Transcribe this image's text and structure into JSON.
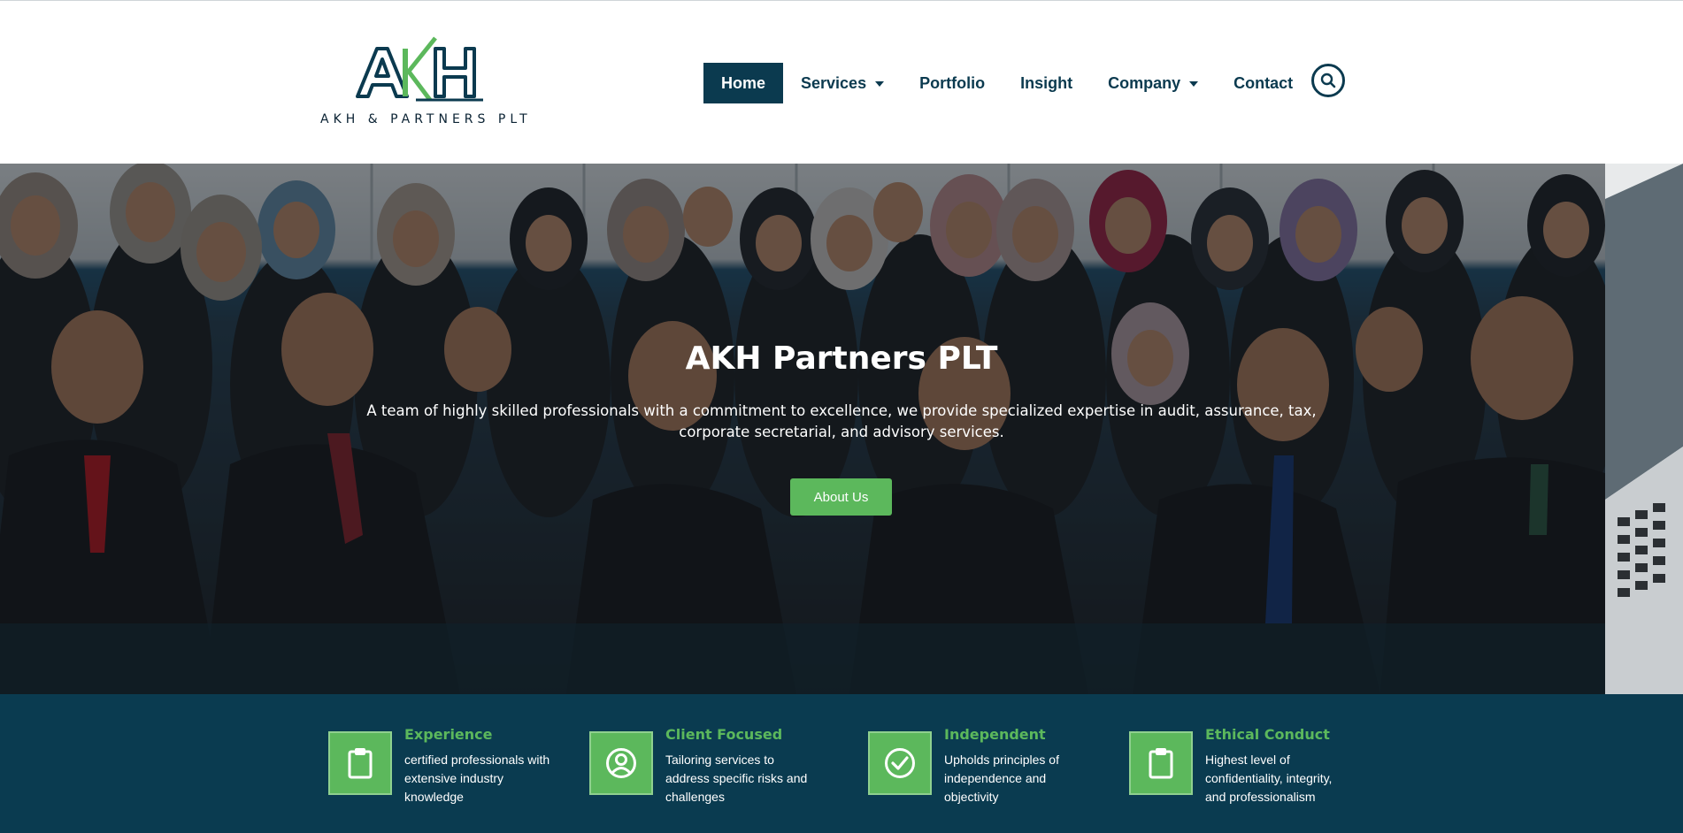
{
  "brand": {
    "logo_letters": "AKH",
    "logo_tagline": "AKH & PARTNERS PLT",
    "colors": {
      "navy": "#0b3a4f",
      "green": "#5cb85c",
      "band": "#0a3b50"
    }
  },
  "nav": {
    "items": [
      {
        "label": "Home",
        "active": true,
        "dropdown": false
      },
      {
        "label": "Services",
        "active": false,
        "dropdown": true
      },
      {
        "label": "Portfolio",
        "active": false,
        "dropdown": false
      },
      {
        "label": "Insight",
        "active": false,
        "dropdown": false
      },
      {
        "label": "Company",
        "active": false,
        "dropdown": true
      },
      {
        "label": "Contact",
        "active": false,
        "dropdown": false
      }
    ],
    "search_icon": "search-icon"
  },
  "hero": {
    "title": "AKH Partners PLT",
    "subtitle": "A team of highly skilled professionals with a commitment to excellence, we provide specialized expertise in audit, assurance, tax, corporate secretarial, and advisory services.",
    "button_label": "About Us"
  },
  "features": [
    {
      "title": "Experience",
      "text": "certified professionals with extensive industry knowledge",
      "icon": "clipboard-icon"
    },
    {
      "title": "Client Focused",
      "text": "Tailoring services to address specific risks and challenges",
      "icon": "user-circle-icon"
    },
    {
      "title": "Independent",
      "text": "Upholds principles of independence and objectivity",
      "icon": "check-circle-icon"
    },
    {
      "title": "Ethical Conduct",
      "text": "Highest level of confidentiality, integrity, and professionalism",
      "icon": "clipboard-icon"
    }
  ]
}
